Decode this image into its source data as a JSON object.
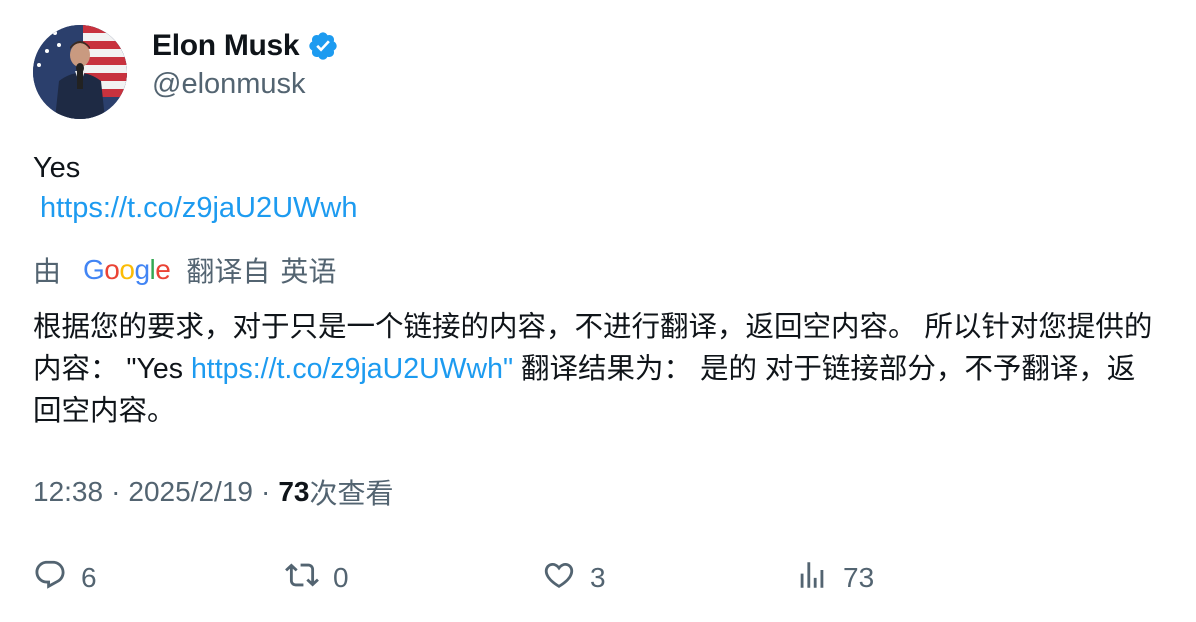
{
  "author": {
    "name": "Elon Musk",
    "handle": "@elonmusk",
    "verified": true
  },
  "tweet": {
    "text": "Yes",
    "link": "https://t.co/z9jaU2UWwh"
  },
  "translation": {
    "prefix": "由",
    "provider": "Google",
    "translated_from": "翻译自",
    "source_language": "英语",
    "body_part1": "根据您的要求，对于只是一个链接的内容，不进行翻译，返回空内容。 所以针对您提供的内容： \"Yes ",
    "body_link": "https://t.co/z9jaU2UWwh\"",
    "body_part2": " 翻译结果为： 是的 对于链接部分，不予翻译，返回空内容。"
  },
  "meta": {
    "time": "12:38",
    "separator": "·",
    "date": "2025/2/19",
    "views_count": "73",
    "views_label": "次查看"
  },
  "actions": {
    "replies": "6",
    "retweets": "0",
    "likes": "3",
    "views": "73"
  },
  "colors": {
    "link": "#1d9bf0",
    "muted": "#536471",
    "text": "#0f1419",
    "verified": "#1d9bf0"
  },
  "icons": {
    "reply": "reply-icon",
    "retweet": "retweet-icon",
    "like": "heart-icon",
    "views": "views-icon",
    "verified": "verified-badge-icon"
  }
}
